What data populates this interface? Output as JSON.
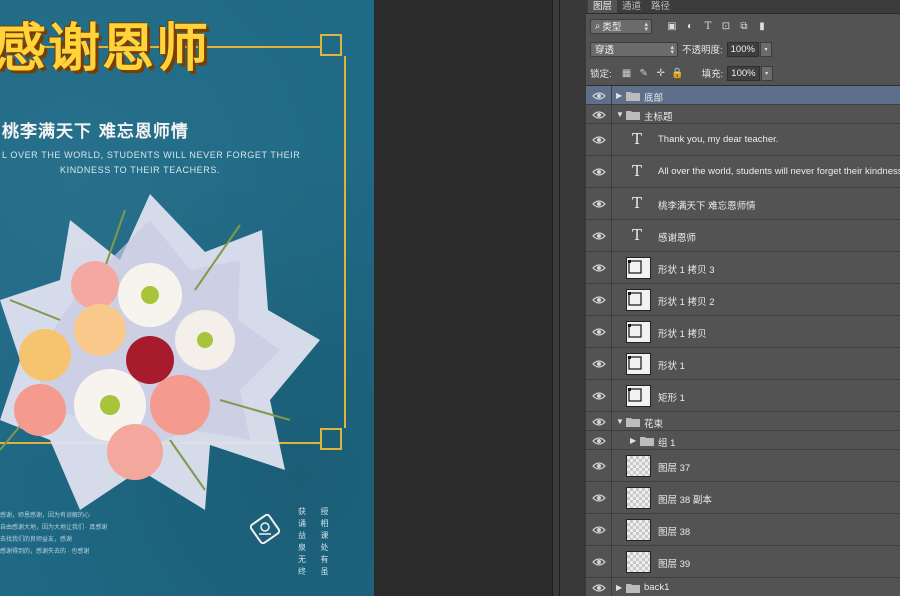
{
  "canvas": {
    "main_title": "感谢恩师",
    "subtitle_cn": "桃李满天下  难忘恩师情",
    "subtitle_en_line1": "L OVER THE WORLD, STUDENTS WILL NEVER FORGET THEIR",
    "subtitle_en_line2": "KINDNESS TO THEIR TEACHERS.",
    "body_lines": [
      "感谢，师恩感谢，因为有谅解的心",
      "自由感谢大地，因为大地让我们 · 真感谢",
      "去找我们的良师益友，感谢",
      "感谢得到的，感谢失去的 · 也感谢"
    ],
    "poem_lines": [
      "获 授 诵 相",
      "益 课 泉 处",
      "无 有 终 虽"
    ]
  },
  "panel": {
    "tabs": [
      "图层",
      "通道",
      "路径"
    ],
    "filter": {
      "kind": "类型"
    },
    "blend_mode": "穿透",
    "opacity_label": "不透明度:",
    "opacity_value": "100%",
    "lock_label": "锁定:",
    "fill_label": "填充:",
    "fill_value": "100%",
    "layers": [
      {
        "name": "底部",
        "kind": "group",
        "level": 0,
        "expanded": false,
        "selected": true
      },
      {
        "name": "主标题",
        "kind": "group",
        "level": 0,
        "expanded": true,
        "selected": false
      },
      {
        "name": "Thank you, my dear teacher.",
        "kind": "text",
        "level": 1
      },
      {
        "name": "All over the world, students will never forget their kindness",
        "kind": "text",
        "level": 1
      },
      {
        "name": "桃李满天下 难忘恩师情",
        "kind": "text",
        "level": 1
      },
      {
        "name": "感谢恩师",
        "kind": "text",
        "level": 1
      },
      {
        "name": "形状 1 拷贝 3",
        "kind": "shape",
        "level": 1
      },
      {
        "name": "形状 1 拷贝 2",
        "kind": "shape",
        "level": 1
      },
      {
        "name": "形状 1 拷贝",
        "kind": "shape",
        "level": 1
      },
      {
        "name": "形状 1",
        "kind": "shape",
        "level": 1
      },
      {
        "name": "矩形 1",
        "kind": "shape",
        "level": 1
      },
      {
        "name": "花束",
        "kind": "group",
        "level": 0,
        "expanded": true
      },
      {
        "name": "组 1",
        "kind": "group",
        "level": 1,
        "expanded": false
      },
      {
        "name": "图层 37",
        "kind": "pixel",
        "level": 1
      },
      {
        "name": "图层 38 副本",
        "kind": "pixel",
        "level": 1
      },
      {
        "name": "图层 38",
        "kind": "pixel",
        "level": 1
      },
      {
        "name": "图层 39",
        "kind": "pixel",
        "level": 1
      },
      {
        "name": "back1",
        "kind": "group",
        "level": 0,
        "expanded": false
      }
    ]
  }
}
